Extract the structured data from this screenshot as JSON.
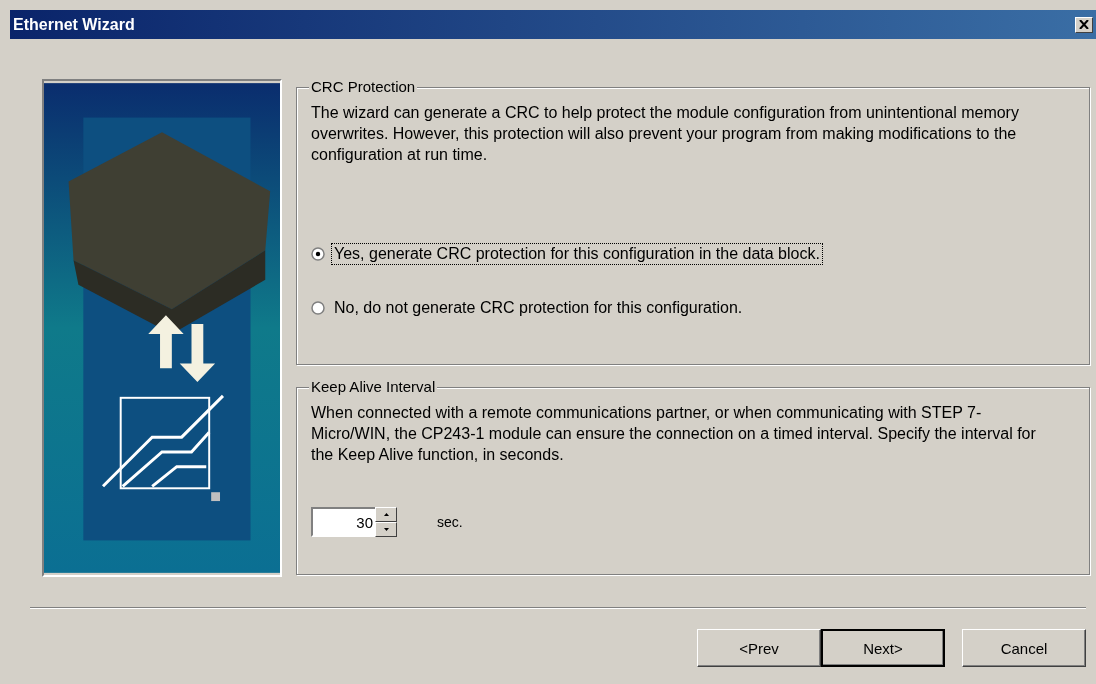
{
  "window": {
    "title": "Ethernet Wizard"
  },
  "crc_protection": {
    "title": "CRC Protection",
    "description": "The wizard can generate a CRC to help protect the module configuration from unintentional memory overwrites. However, this protection will also prevent your program from making modifications to the configuration at run time.",
    "options": [
      {
        "label": "Yes, generate CRC protection for this configuration in the data block.",
        "selected": true,
        "focused": true
      },
      {
        "label": "No, do not generate CRC protection for this configuration.",
        "selected": false,
        "focused": false
      }
    ]
  },
  "keep_alive": {
    "title": "Keep Alive Interval",
    "description": "When connected with a remote communications partner, or when communicating with STEP 7-Micro/WIN, the CP243-1 module can ensure the connection on a timed interval. Specify the interval for the Keep Alive function, in seconds.",
    "interval": {
      "value": "30"
    },
    "unit": "sec."
  },
  "buttons": [
    {
      "label": "<Prev",
      "default": false
    },
    {
      "label": "Next>",
      "default": true
    },
    {
      "label": "Cancel",
      "default": false
    }
  ]
}
